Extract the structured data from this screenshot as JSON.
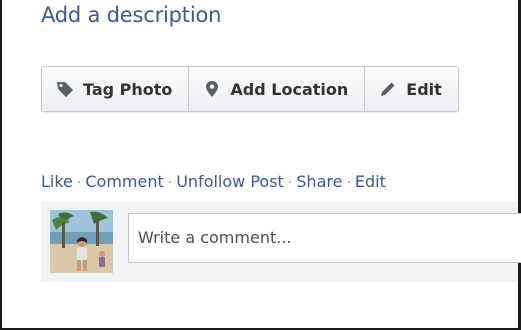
{
  "post": {
    "description_link": "Add a description"
  },
  "action_bar": {
    "tag_photo_label": "Tag Photo",
    "add_location_label": "Add Location",
    "edit_label": "Edit",
    "icons": [
      "tag-icon",
      "map-marker-icon",
      "pencil-icon"
    ]
  },
  "post_actions": {
    "like": "Like",
    "comment": "Comment",
    "unfollow": "Unfollow Post",
    "share": "Share",
    "edit": "Edit",
    "separator": "·"
  },
  "comment_box": {
    "placeholder": "Write a comment..."
  },
  "colors": {
    "link": "#3b5998",
    "button_text": "#333333",
    "comment_bg": "#f2f3f5"
  }
}
